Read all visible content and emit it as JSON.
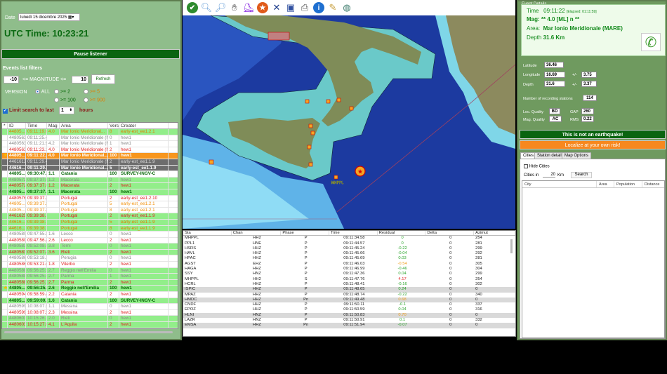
{
  "left": {
    "date_label": "Date",
    "date_value": "lunedì 15 dicembre 2025",
    "utc_time": "UTC Time: 10:23:21",
    "pause_button": "Pause listener",
    "filters_title": "Events list filters",
    "mag_min": "-10",
    "mag_label": "<= MAGNITUDE <=",
    "mag_max": "10",
    "refresh_button": "Refresh",
    "version_label": "VERSION",
    "version_options": [
      "ALL",
      ">= 2",
      ">= 5",
      ">= 100",
      ">= 900"
    ],
    "version_selected": "ALL",
    "limit_label": "Limit search to last",
    "limit_value": "1",
    "limit_unit": "hours",
    "limit_checked": true
  },
  "events": {
    "columns": [
      "*",
      "ID",
      "Time",
      "Mag",
      "Area",
      "Version",
      "Creator"
    ],
    "rows": [
      {
        "id": "44805...",
        "time": "09:11:19.66",
        "mag": "4.0",
        "area": "Mar Ionio Meridional...",
        "version": "8",
        "creator": "early-est_ee1.2.1",
        "bg": "green",
        "fg": "orange"
      },
      {
        "id": "44805632",
        "time": "09:11:25.41",
        "mag": "",
        "area": "Mar Ionio Meridionale (MA...",
        "version": "0",
        "creator": "hew1",
        "bg": "white",
        "fg": "gray"
      },
      {
        "id": "44805632",
        "time": "09:11:21.91",
        "mag": "4.2",
        "area": "Mar Ionio Meridionale (MA...",
        "version": "1",
        "creator": "hew1",
        "bg": "white",
        "fg": "gray"
      },
      {
        "id": "44805632",
        "time": "09:11:23.14",
        "mag": "4.0",
        "area": "Mar Ionio Meridionale (MA...",
        "version": "2",
        "creator": "hew1",
        "bg": "white",
        "fg": "red"
      },
      {
        "id": "44805...",
        "time": "09:11:22.26",
        "mag": "4.0",
        "area": "Mar Ionio Meridional...",
        "version": "100",
        "creator": "hew1",
        "bg": "orange",
        "fg": "white",
        "star": true
      },
      {
        "id": "44616121",
        "time": "09:11:29.47",
        "mag": "",
        "area": "Mar Ionio Meridionale (MA...",
        "version": "2",
        "creator": "early-est_ee1.1.9",
        "bg": "dark",
        "fg": "light"
      },
      {
        "id": "44616...",
        "time": "09:11:29.47",
        "mag": "",
        "area": "Mar Ionio Meridional...",
        "version": "5",
        "creator": "early-est_ee1.1.9",
        "bg": "dark",
        "fg": "white"
      },
      {
        "id": "44805...",
        "time": "09:30:47.95",
        "mag": "1.1",
        "area": "Catania",
        "version": "100",
        "creator": "SURVEY-INGV-C",
        "bg": "white",
        "fg": "green"
      },
      {
        "id": "44805722",
        "time": "09:37:37.01",
        "mag": "1.2",
        "area": "Macerata",
        "version": "0",
        "creator": "hew1",
        "bg": "green",
        "fg": "gray"
      },
      {
        "id": "44805722",
        "time": "09:37:37.01",
        "mag": "1.2",
        "area": "Macerata",
        "version": "2",
        "creator": "hew1",
        "bg": "green",
        "fg": "red"
      },
      {
        "id": "44805...",
        "time": "09:37:37.58",
        "mag": "1.1",
        "area": "Macerata",
        "version": "100",
        "creator": "hew1",
        "bg": "green",
        "fg": "green"
      },
      {
        "id": "44805762",
        "time": "09:39:37.25",
        "mag": "",
        "area": "Portugal",
        "version": "2",
        "creator": "early-est_ee1.2.10",
        "bg": "white",
        "fg": "red"
      },
      {
        "id": "44805...",
        "time": "09:39:37.25",
        "mag": "",
        "area": "Portugal",
        "version": "5",
        "creator": "early-est_ee1.2.1",
        "bg": "white",
        "fg": "orange"
      },
      {
        "id": "44805...",
        "time": "09:39:37.25",
        "mag": "",
        "area": "Portugal",
        "version": "8",
        "creator": "early-est_ee1.2.1",
        "bg": "white",
        "fg": "orange"
      },
      {
        "id": "44616251",
        "time": "09:39:38.77",
        "mag": "",
        "area": "Portugal",
        "version": "2",
        "creator": "early-est_ee1.1.9",
        "bg": "green",
        "fg": "red"
      },
      {
        "id": "44616...",
        "time": "09:39:38.77",
        "mag": "",
        "area": "Portugal",
        "version": "5",
        "creator": "early-est_ee1.1.9",
        "bg": "green",
        "fg": "orange"
      },
      {
        "id": "44616...",
        "time": "09:39:38.77",
        "mag": "",
        "area": "Portugal",
        "version": "8",
        "creator": "early-est_ee1.1.9",
        "bg": "green",
        "fg": "orange"
      },
      {
        "id": "44805802",
        "time": "09:47:55.84",
        "mag": "1.6",
        "area": "Lecco",
        "version": "0",
        "creator": "hew1",
        "bg": "white",
        "fg": "gray"
      },
      {
        "id": "44805802",
        "time": "09:47:56.89",
        "mag": "2.6",
        "area": "Lecco",
        "version": "2",
        "creator": "hew1",
        "bg": "white",
        "fg": "red"
      },
      {
        "id": "44805832",
        "time": "09:52:08.68",
        "mag": "3.8",
        "area": "Terni",
        "version": "0",
        "creator": "hew1",
        "bg": "green",
        "fg": "gray"
      },
      {
        "id": "44805832",
        "time": "09:52:07.46",
        "mag": "3.6",
        "area": "Rieti",
        "version": "2",
        "creator": "hew1",
        "bg": "green",
        "fg": "red"
      },
      {
        "id": "44805862",
        "time": "09:53:18.16",
        "mag": "",
        "area": "Perugia",
        "version": "0",
        "creator": "hew1",
        "bg": "white",
        "fg": "gray"
      },
      {
        "id": "44805862",
        "time": "09:53:21.62",
        "mag": "1.8",
        "area": "Viterbo",
        "version": "2",
        "creator": "hew1",
        "bg": "white",
        "fg": "red"
      },
      {
        "id": "44805882",
        "time": "09:56:25.91",
        "mag": "2.7",
        "area": "Reggio nell'Emilia",
        "version": "0",
        "creator": "hew1",
        "bg": "green",
        "fg": "gray"
      },
      {
        "id": "44805882",
        "time": "09:56:25.62",
        "mag": "2.7",
        "area": "Parma",
        "version": "1",
        "creator": "hew1",
        "bg": "green",
        "fg": "gray"
      },
      {
        "id": "44805882",
        "time": "09:56:25.76",
        "mag": "2.7",
        "area": "Parma",
        "version": "2",
        "creator": "hew1",
        "bg": "green",
        "fg": "red"
      },
      {
        "id": "44805...",
        "time": "09:56:25.47",
        "mag": "2.6",
        "area": "Reggio nell'Emilia",
        "version": "100",
        "creator": "hew1",
        "bg": "green",
        "fg": "green",
        "star": true
      },
      {
        "id": "44805942",
        "time": "09:58:59.40",
        "mag": "2.2",
        "area": "Catania",
        "version": "2",
        "creator": "hew1",
        "bg": "white",
        "fg": "red"
      },
      {
        "id": "44805...",
        "time": "09:59:00.07",
        "mag": "1.6",
        "area": "Catania",
        "version": "100",
        "creator": "SURVEY-INGV-C",
        "bg": "green",
        "fg": "green"
      },
      {
        "id": "44805992",
        "time": "10:08:07.59",
        "mag": "1.1",
        "area": "Messina",
        "version": "0",
        "creator": "hew1",
        "bg": "white",
        "fg": "gray"
      },
      {
        "id": "44805992",
        "time": "10:08:07.59",
        "mag": "2.3",
        "area": "Messina",
        "version": "2",
        "creator": "hew1",
        "bg": "white",
        "fg": "red"
      },
      {
        "id": "44806032",
        "time": "10:15:26.10",
        "mag": "2.0",
        "area": "Rieti",
        "version": "0",
        "creator": "hew1",
        "bg": "green",
        "fg": "gray"
      },
      {
        "id": "44806032",
        "time": "10:15:27.62",
        "mag": "4.1",
        "area": "L'Aquila",
        "version": "2",
        "creator": "hew1",
        "bg": "green",
        "fg": "red"
      }
    ]
  },
  "toolbar": [
    "check-icon",
    "zoom-in-icon",
    "zoom-out-icon",
    "pan-hand-icon",
    "italy-icon",
    "epicenter-star-icon",
    "close-x-icon",
    "image-icon",
    "print-icon",
    "info-icon",
    "pencil-icon",
    "globe-icon"
  ],
  "map": {
    "station_label": "MHPPL"
  },
  "stations": {
    "columns": [
      "Sta",
      "Chan",
      "Phase",
      "Time",
      "Residual",
      "Delta",
      "Azimut"
    ],
    "rows": [
      {
        "sta": "MHPPL",
        "chan": "HH2",
        "phase": "P",
        "time": "09:11:34.58",
        "res": "0",
        "rc": "green",
        "delta": "0",
        "az": "254"
      },
      {
        "sta": "PPL1",
        "chan": "HNE",
        "phase": "P",
        "time": "09:11:44.57",
        "res": "0",
        "rc": "green",
        "delta": "0",
        "az": "281"
      },
      {
        "sta": "HSRS",
        "chan": "HHZ",
        "phase": "P",
        "time": "09:11:45.24",
        "res": "-0.22",
        "rc": "green",
        "delta": "0",
        "az": "299"
      },
      {
        "sta": "HAVL",
        "chan": "HHZ",
        "phase": "P",
        "time": "09:11:45.66",
        "res": "-0.04",
        "rc": "green",
        "delta": "0",
        "az": "292"
      },
      {
        "sta": "HPAC",
        "chan": "HHZ",
        "phase": "P",
        "time": "09:11:45.69",
        "res": "0.03",
        "rc": "green",
        "delta": "0",
        "az": "281"
      },
      {
        "sta": "AGST",
        "chan": "EHZ",
        "phase": "P",
        "time": "09:11:46.03",
        "res": "-0.54",
        "rc": "orange",
        "delta": "0",
        "az": "305"
      },
      {
        "sta": "HAGA",
        "chan": "HHZ",
        "phase": "P",
        "time": "09:11:46.99",
        "res": "-0.46",
        "rc": "green",
        "delta": "0",
        "az": "304"
      },
      {
        "sta": "SSY",
        "chan": "HNZ",
        "phase": "P",
        "time": "09:11:47.36",
        "res": "0.04",
        "rc": "green",
        "delta": "0",
        "az": "299"
      },
      {
        "sta": "MHPPL",
        "chan": "HH2",
        "phase": "S",
        "time": "09:11:47.76",
        "res": "4.17",
        "rc": "red",
        "delta": "0",
        "az": "254"
      },
      {
        "sta": "HCRL",
        "chan": "HHZ",
        "phase": "P",
        "time": "09:11:48.41",
        "res": "-0.16",
        "rc": "green",
        "delta": "0",
        "az": "302"
      },
      {
        "sta": "ISPIC",
        "chan": "HHZ",
        "phase": "P",
        "time": "09:11:48.65",
        "res": "0.24",
        "rc": "green",
        "delta": "0",
        "az": "0",
        "alt": true
      },
      {
        "sta": "MPAZ",
        "chan": "HHZ",
        "phase": "P",
        "time": "09:11:48.74",
        "res": "-0.22",
        "rc": "green",
        "delta": "0",
        "az": "340"
      },
      {
        "sta": "HMDC",
        "chan": "HHZ",
        "phase": "Pn",
        "time": "09:11:49.48",
        "res": "0.68",
        "rc": "orange",
        "delta": "0",
        "az": "0",
        "alt": true
      },
      {
        "sta": "CNDF",
        "chan": "HHZ",
        "phase": "P",
        "time": "09:11:50.11",
        "res": "-0.1",
        "rc": "green",
        "delta": "0",
        "az": "337"
      },
      {
        "sta": "EPOZ",
        "chan": "HHZ",
        "phase": "P",
        "time": "09:11:50.59",
        "res": "0.04",
        "rc": "green",
        "delta": "0",
        "az": "316"
      },
      {
        "sta": "HLNI",
        "chan": "HNZ",
        "phase": "P",
        "time": "09:11:50.83",
        "res": "0.70",
        "rc": "orange",
        "delta": "0",
        "az": "0",
        "alt": true
      },
      {
        "sta": "LAZR",
        "chan": "HNZ",
        "phase": "P",
        "time": "09:11:50.91",
        "res": "0.1",
        "rc": "green",
        "delta": "0",
        "az": "332"
      },
      {
        "sta": "EMSA",
        "chan": "HHZ",
        "phase": "Pn",
        "time": "09:11:51.94",
        "res": "-0.07",
        "rc": "green",
        "delta": "0",
        "az": "0",
        "alt": true
      }
    ]
  },
  "details": {
    "title": "Event Details",
    "time_label": "Time",
    "time": "09:11:22",
    "elapsed": "[Elapsed: 01:11:59]",
    "mag": "Mag: ** 4.0 [ML] n **",
    "area_label": "Area:",
    "area": "Mar Ionio Meridionale (MARE)",
    "depth_label": "Depth",
    "depth": "31.6 Km",
    "lat_label": "Latitude",
    "lat": "36.46",
    "lon_label": "Longitude",
    "lon": "16.69",
    "lon_err": "3.75",
    "dep_label": "Depth",
    "dep": "31.6",
    "dep_err": "3.37",
    "pm": "+/-",
    "nsta_label": "Number of recording stations",
    "nsta": "114",
    "locq_label": "Loc. Quality",
    "locq": "BD",
    "gap_label": "GAP",
    "gap": "260",
    "magq_label": "Mag. Quality",
    "magq": "AC",
    "rms_label": "RMS",
    "rms": "0.22",
    "not_eq_button": "This is not an earthquake!",
    "localize_button": "Localize at your own risk!",
    "tabs": [
      "Cities",
      "Station details",
      "Map Options"
    ],
    "hide_cities": "Hide Cities",
    "cities_in": "Cities in",
    "cities_km": "20",
    "km": "Km",
    "search_button": "Search",
    "city_columns": [
      "City",
      "Area",
      "Population",
      "Distance"
    ]
  },
  "colors": {
    "panel": "#8fbd8b",
    "accent_dark_green": "#0a6410",
    "orange": "#f7961e",
    "sea": "#1c3aa0"
  }
}
